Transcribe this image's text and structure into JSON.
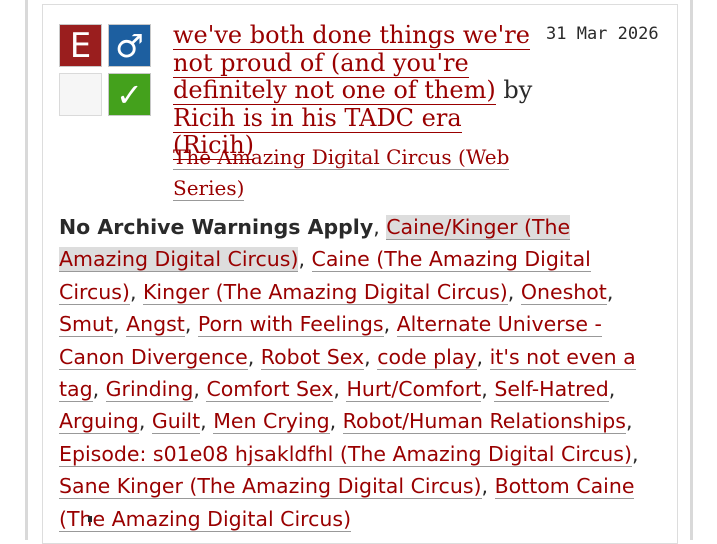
{
  "work": {
    "title": "we've both done things we're not proud of (and you're definitely not one of them)",
    "by_text": "by",
    "author": "Ricih is in his TADC era (Ricih)",
    "date": "31 Mar 2026",
    "fandom": "The Amazing Digital Circus (Web Series)",
    "icons": {
      "rating_glyph": "E",
      "category_glyph": "♂",
      "complete_glyph": "✓",
      "rating_color": "#9a1e1e",
      "category_color": "#1d5fa0",
      "complete_color": "#44a11c"
    }
  },
  "tags": {
    "warning": "No Archive Warnings Apply",
    "relationships": [
      "Caine/Kinger (The Amazing Digital Circus)"
    ],
    "characters": [
      "Caine (The Amazing Digital Circus)",
      "Kinger (The Amazing Digital Circus)"
    ],
    "freeforms": [
      "Oneshot",
      "Smut",
      "Angst",
      "Porn with Feelings",
      "Alternate Universe - Canon Divergence",
      "Robot Sex",
      "code play",
      "it's not even a tag",
      "Grinding",
      "Comfort Sex",
      "Hurt/Comfort",
      "Self-Hatred",
      "Arguing",
      "Guilt",
      "Men Crying",
      "Robot/Human Relationships",
      "Episode: s01e08 hjsakldfhl (The Amazing Digital Circus)",
      "Sane Kinger (The Amazing Digital Circus)",
      "Bottom Caine (The Amazing Digital Circus)"
    ],
    "separator": ","
  }
}
